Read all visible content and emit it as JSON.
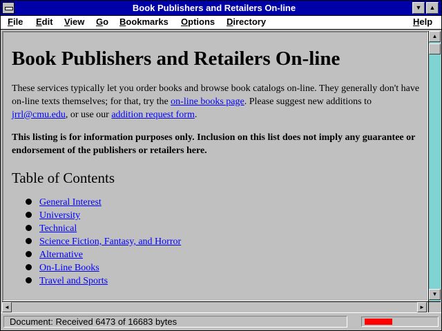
{
  "window": {
    "title": "Book Publishers and Retailers On-line"
  },
  "menubar": {
    "items": [
      {
        "label": "File",
        "accel": "F",
        "rest": "ile"
      },
      {
        "label": "Edit",
        "accel": "E",
        "rest": "dit"
      },
      {
        "label": "View",
        "accel": "V",
        "rest": "iew"
      },
      {
        "label": "Go",
        "accel": "G",
        "rest": "o"
      },
      {
        "label": "Bookmarks",
        "accel": "B",
        "rest": "ookmarks"
      },
      {
        "label": "Options",
        "accel": "O",
        "rest": "ptions"
      },
      {
        "label": "Directory",
        "accel": "D",
        "rest": "irectory"
      },
      {
        "label": "Help",
        "accel": "H",
        "rest": "elp"
      }
    ]
  },
  "document": {
    "heading": "Book Publishers and Retailers On-line",
    "intro": {
      "text1": "These services typically let you order books and browse book catalogs on-line. They generally don't have on-line texts themselves; for that, try the ",
      "link1": "on-line books page",
      "text2": ". Please suggest new additions to ",
      "link2": "jrrl@cmu.edu",
      "text3": ", or use our ",
      "link3": "addition request form",
      "text4": "."
    },
    "disclaimer": "This listing is for information purposes only. Inclusion on this list does not imply any guarantee or endorsement of the publishers or retailers here.",
    "toc_heading": "Table of Contents",
    "toc": [
      "General Interest",
      "University",
      "Technical",
      "Science Fiction, Fantasy, and Horror",
      "Alternative",
      "On-Line Books",
      "Travel and Sports"
    ]
  },
  "status": {
    "text": "Document: Received 6473 of 16683 bytes",
    "progress_fraction": 0.388
  },
  "icons": {
    "system_menu": "system-menu-icon",
    "minimize": "minimize-icon",
    "maximize": "maximize-icon",
    "scroll_up": "arrow-up-icon",
    "scroll_down": "arrow-down-icon",
    "scroll_left": "arrow-left-icon",
    "scroll_right": "arrow-right-icon"
  },
  "colors": {
    "titlebar": "#0000a8",
    "link": "#0000ff",
    "progress": "#ff0000",
    "scroll_track": "#7fd3d3"
  }
}
